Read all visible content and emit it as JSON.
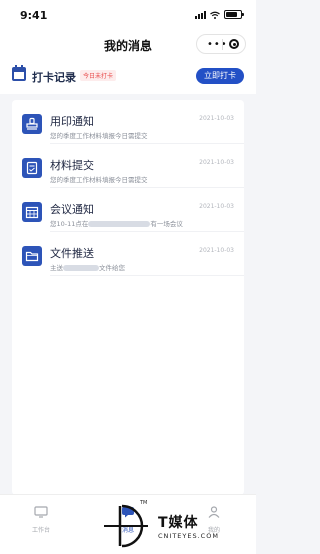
{
  "status_bar": {
    "time": "9:41"
  },
  "nav": {
    "title": "我的消息"
  },
  "checkin": {
    "title": "打卡记录",
    "badge": "今日未打卡",
    "button": "立即打卡"
  },
  "messages": [
    {
      "title": "用印通知",
      "desc_before": "您的季度工作材料填报今日需提交",
      "desc_after": "",
      "date": "2021-10-03",
      "icon": "stamp-icon"
    },
    {
      "title": "材料提交",
      "desc_before": "您的季度工作材料填报今日需提交",
      "desc_after": "",
      "date": "2021-10-03",
      "icon": "document-icon"
    },
    {
      "title": "会议通知",
      "desc_before": "您10-11点在",
      "desc_after": "有一场会议",
      "date": "2021-10-03",
      "icon": "calendar-grid-icon"
    },
    {
      "title": "文件推送",
      "desc_before": "主送",
      "desc_after": "文件给您",
      "date": "2021-10-03",
      "icon": "folder-icon"
    }
  ],
  "tabbar": {
    "items": [
      {
        "label": "工作台",
        "icon": "monitor-icon",
        "active": false
      },
      {
        "label": "消息",
        "icon": "message-icon",
        "active": true
      },
      {
        "label": "我的",
        "icon": "person-icon",
        "active": false
      }
    ]
  },
  "watermark": {
    "text": "T媒体",
    "sub": "CNITEYES.COM",
    "tm": "TM"
  },
  "colors": {
    "accent": "#2350c6",
    "icon_bg": "#2d54b8",
    "badge_red": "#e84b4b",
    "page_bg": "#f4f5f8"
  }
}
